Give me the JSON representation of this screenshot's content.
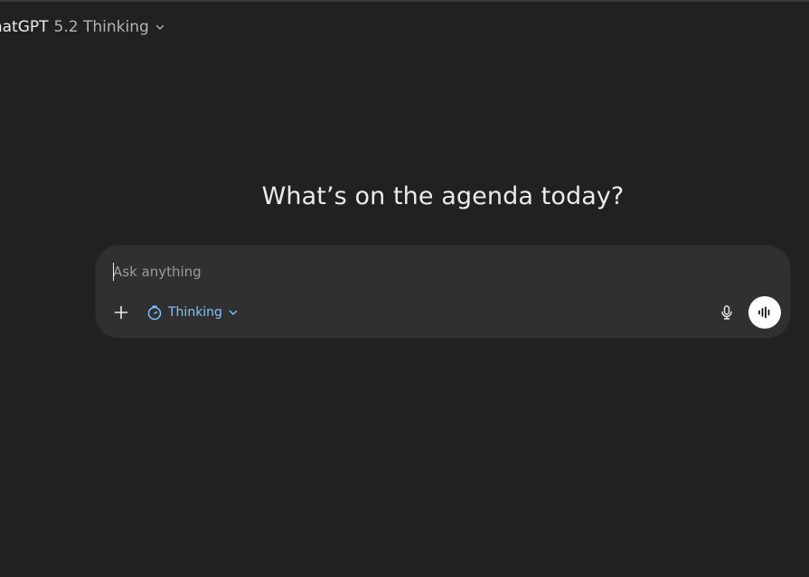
{
  "header": {
    "model_name": "ChatGPT",
    "model_version": "5.2 Thinking"
  },
  "main": {
    "headline": "What’s on the agenda today?"
  },
  "composer": {
    "placeholder": "Ask anything",
    "value": "",
    "mode_label": "Thinking"
  },
  "icons": {
    "model_chevron": "chevron-down-icon",
    "plus": "plus-icon",
    "thinking": "timer-icon",
    "mode_chevron": "chevron-down-icon",
    "mic": "microphone-icon",
    "voice": "voice-waveform-icon"
  },
  "colors": {
    "background": "#212121",
    "composer": "#303030",
    "accent": "#7cc4ff",
    "voice_button": "#ffffff"
  }
}
